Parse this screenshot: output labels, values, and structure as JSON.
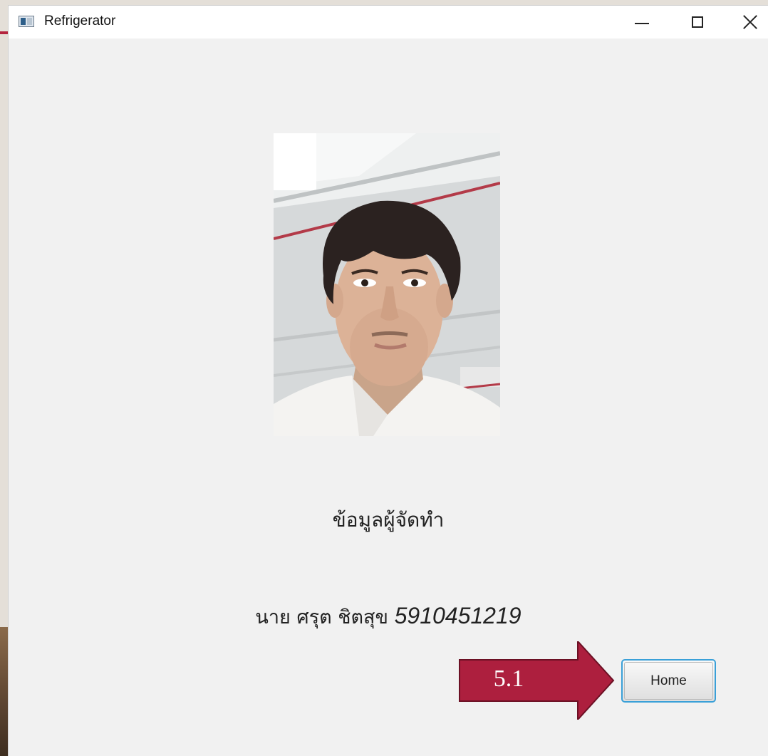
{
  "window": {
    "title": "Refrigerator",
    "app_icon": "app-window-icon",
    "controls": {
      "minimize_icon": "minimize-icon",
      "maximize_icon": "maximize-icon",
      "close_icon": "close-icon"
    }
  },
  "content": {
    "photo_alt": "photo",
    "heading": "ข้อมูลผู้จัดทำ",
    "name": "นาย ศรุต ชิตสุข",
    "student_id": "5910451219",
    "home_button": "Home"
  },
  "annotation": {
    "label": "5.1",
    "color": "#ad1f3e"
  }
}
